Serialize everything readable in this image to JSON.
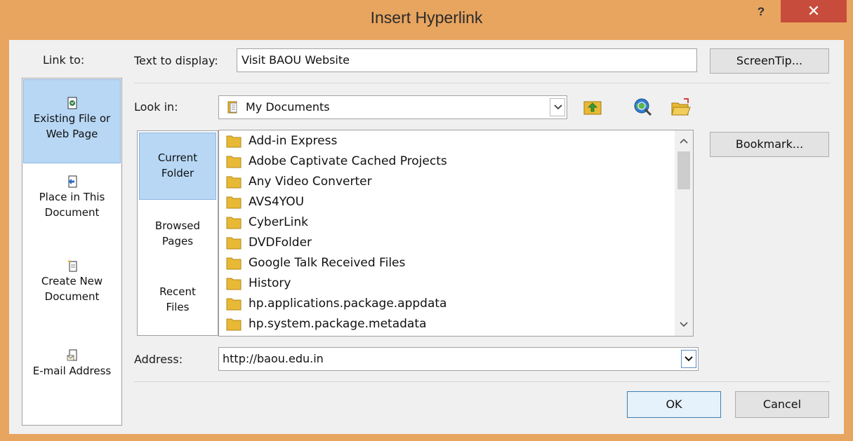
{
  "window": {
    "title": "Insert Hyperlink",
    "help_label": "?",
    "close_label": "✕"
  },
  "link_to": {
    "label": "Link to:",
    "items": [
      {
        "line1": "Existing File or",
        "line2": "Web Page",
        "icon": "existing-file-icon",
        "selected": true
      },
      {
        "line1": "Place in This",
        "line2": "Document",
        "icon": "place-in-document-icon",
        "selected": false
      },
      {
        "line1": "Create New",
        "line2": "Document",
        "icon": "new-document-icon",
        "selected": false
      },
      {
        "line1": "E-mail Address",
        "line2": "",
        "icon": "email-icon",
        "selected": false
      }
    ]
  },
  "text_to_display": {
    "label": "Text to display:",
    "value": "Visit BAOU Website"
  },
  "screentip_label": "ScreenTip...",
  "look_in": {
    "label": "Look in:",
    "value": "My Documents",
    "icon": "my-documents-icon"
  },
  "toolbar": {
    "up_folder_icon": "up-folder-icon",
    "browse_web_icon": "browse-web-icon",
    "browse_file_icon": "browse-file-icon"
  },
  "sub_nav": {
    "items": [
      {
        "line1": "Current",
        "line2": "Folder",
        "selected": true
      },
      {
        "line1": "Browsed",
        "line2": "Pages",
        "selected": false
      },
      {
        "line1": "Recent",
        "line2": "Files",
        "selected": false
      }
    ]
  },
  "files": [
    "Add-in Express",
    "Adobe Captivate Cached Projects",
    "Any Video Converter",
    "AVS4YOU",
    "CyberLink",
    "DVDFolder",
    "Google Talk Received Files",
    "History",
    "hp.applications.package.appdata",
    "hp.system.package.metadata"
  ],
  "bookmark_label": "Bookmark...",
  "address": {
    "label": "Address:",
    "value": "http://baou.edu.in"
  },
  "ok_label": "OK",
  "cancel_label": "Cancel",
  "colors": {
    "frame": "#e8a55f",
    "close": "#c74c3c",
    "selected": "#b7d7f5",
    "folder": "#e8b935"
  }
}
